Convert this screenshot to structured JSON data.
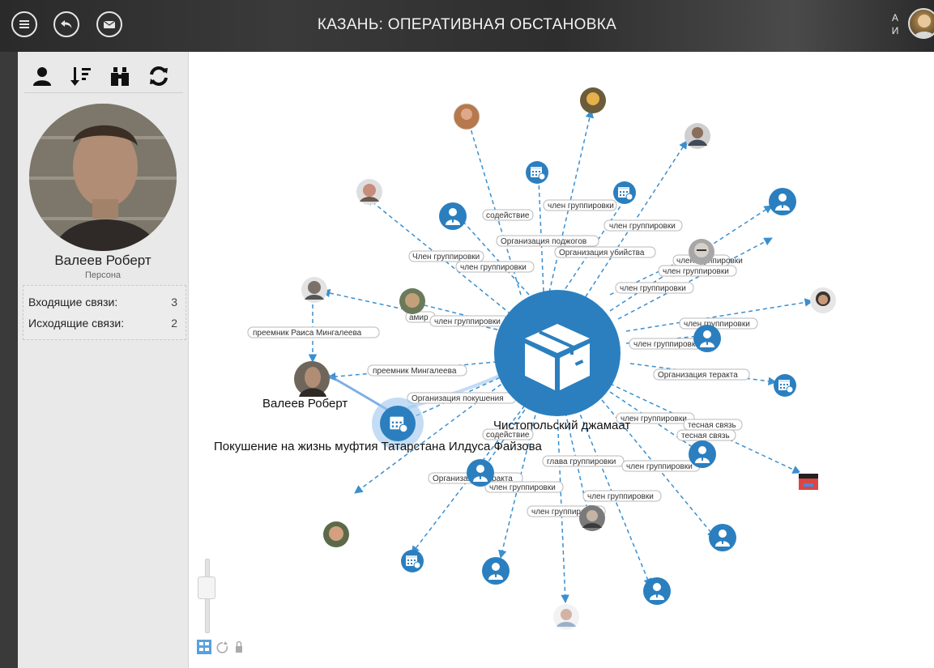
{
  "header": {
    "title": "КАЗАНЬ: ОПЕРАТИВНАЯ ОБСТАНОВКА",
    "user_initials_1": "А",
    "user_initials_2": "И",
    "buttons": [
      "menu-icon",
      "back-icon",
      "mail-icon"
    ]
  },
  "sidebar": {
    "toolbar_icons": [
      "person-icon",
      "sort-icon",
      "binoculars-icon",
      "refresh-icon"
    ],
    "person_name": "Валеев Роберт",
    "person_type": "Персона",
    "incoming_label": "Входящие связи:",
    "incoming_value": "3",
    "outgoing_label": "Исходящие связи:",
    "outgoing_value": "2"
  },
  "graph": {
    "center_label": "Чистопольский джамаат",
    "selected_person_label": "Валеев Роберт",
    "event_label": "Покушение на жизнь муфтия Татарстана Илдуса Файзова",
    "edge_labels": [
      "содействие",
      "член группировки",
      "член группировки",
      "Организация поджогов",
      "Организация убийства",
      "Член группировки",
      "член группировки",
      "член группировки",
      "член группировки",
      "член группировки",
      "амир",
      "член группировки",
      "преемник Раиса Мингалеева",
      "член группировки",
      "член группировки",
      "преемник Мингалеева",
      "Организация теракта",
      "Организация покушения",
      "член группировки",
      "тесная связь",
      "тесная связь",
      "содействие",
      "глава группировки",
      "член группировки",
      "Организация теракта",
      "член группировки",
      "член группировки",
      "член группировки"
    ],
    "icon_names": [
      "box-icon",
      "calendar-event-icon",
      "person-node-icon",
      "photo-node"
    ],
    "colors": {
      "accent": "#2b7fbf",
      "edge": "#3a8fd0",
      "header": "#2e2e2e",
      "sidebar": "#e9e9e9"
    }
  },
  "controls": {
    "icons": [
      "graph-layout-icon",
      "rotate-icon",
      "lock-icon"
    ]
  }
}
